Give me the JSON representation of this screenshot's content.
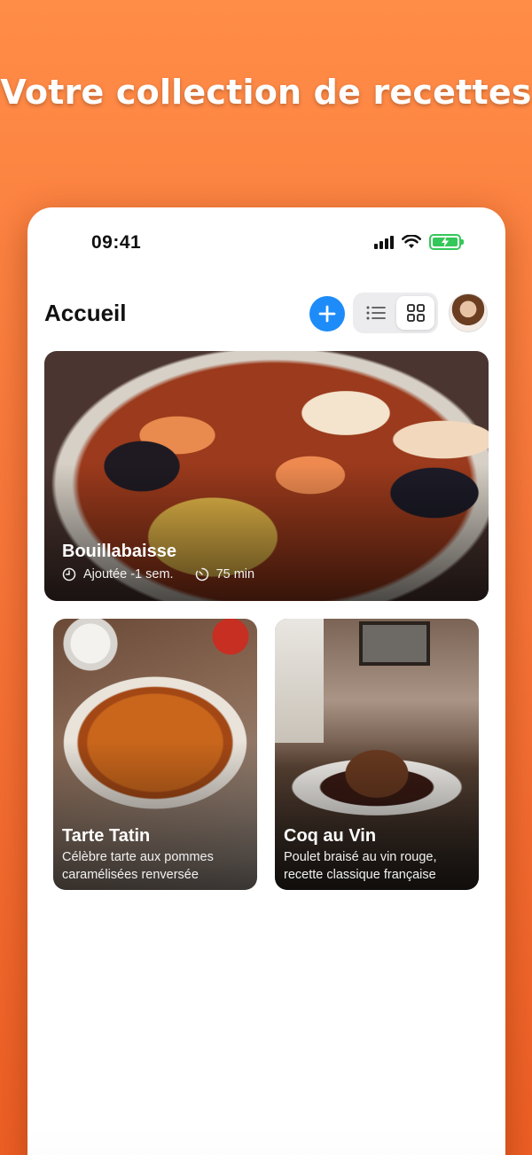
{
  "headline": "Votre collection de recettes",
  "status_bar": {
    "time": "09:41"
  },
  "header": {
    "title": "Accueil",
    "add_icon": "plus-icon",
    "view_modes": [
      "list-icon",
      "grid-icon"
    ],
    "active_view": "grid",
    "accent_color": "#1d8cf8"
  },
  "recipes": [
    {
      "name": "Bouillabaisse",
      "added": "Ajoutée -1 sem.",
      "duration": "75 min"
    },
    {
      "name": "Tarte Tatin",
      "description_line1": "Célèbre tarte aux pommes",
      "description_line2": "caramélisées renversée"
    },
    {
      "name": "Coq au Vin",
      "description_line1": "Poulet braisé au vin rouge,",
      "description_line2": "recette classique française"
    }
  ]
}
